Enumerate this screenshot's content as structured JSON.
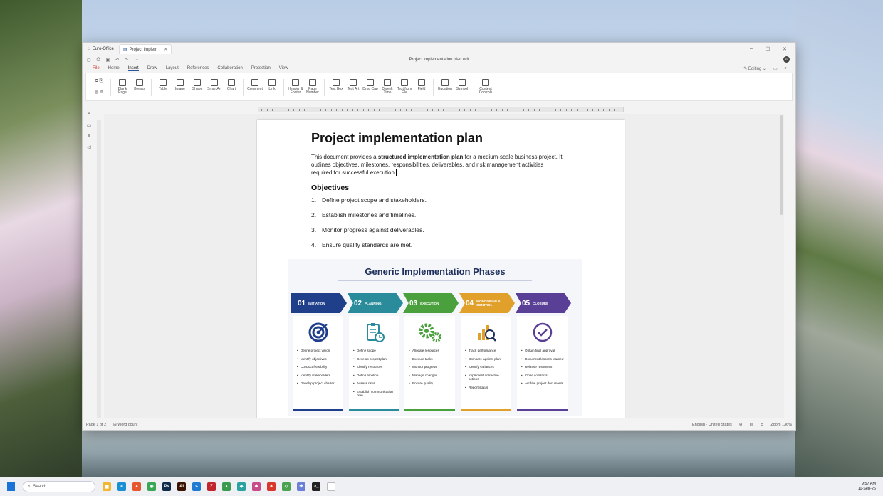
{
  "window": {
    "tabs": [
      {
        "label": "Euro-Office",
        "active": false
      },
      {
        "label": "Project implem",
        "active": true
      }
    ],
    "doc_title": "Project implementation plan.odt",
    "avatar": "EI",
    "menu": [
      "File",
      "Home",
      "Insert",
      "Draw",
      "Layout",
      "References",
      "Collaboration",
      "Protection",
      "View"
    ],
    "active_menu": "Insert",
    "mode": "Editing"
  },
  "ribbon": {
    "buttons": [
      {
        "label": "Blank Page",
        "icon": "blank-page-icon"
      },
      {
        "label": "Breaks",
        "icon": "breaks-icon"
      },
      {
        "label": "Table",
        "icon": "table-icon"
      },
      {
        "label": "Image",
        "icon": "image-icon"
      },
      {
        "label": "Shape",
        "icon": "shape-icon"
      },
      {
        "label": "SmartArt",
        "icon": "smartart-icon"
      },
      {
        "label": "Chart",
        "icon": "chart-icon"
      },
      {
        "label": "Comment",
        "icon": "comment-icon"
      },
      {
        "label": "Link",
        "icon": "link-icon"
      },
      {
        "label": "Header & Footer",
        "icon": "header-footer-icon"
      },
      {
        "label": "Page Number",
        "icon": "page-number-icon"
      },
      {
        "label": "Text Box",
        "icon": "text-box-icon"
      },
      {
        "label": "Text Art",
        "icon": "text-art-icon"
      },
      {
        "label": "Drop Cap",
        "icon": "drop-cap-icon"
      },
      {
        "label": "Date & Time",
        "icon": "date-time-icon"
      },
      {
        "label": "Text from File",
        "icon": "text-from-file-icon"
      },
      {
        "label": "Field",
        "icon": "field-icon"
      },
      {
        "label": "Equation",
        "icon": "equation-icon"
      },
      {
        "label": "Symbol",
        "icon": "symbol-icon"
      },
      {
        "label": "Content Controls",
        "icon": "content-controls-icon"
      }
    ]
  },
  "document": {
    "title": "Project implementation plan",
    "intro_1": "This document provides a ",
    "intro_bold": "structured implementation plan",
    "intro_2": " for a medium-scale business project. It outlines objectives, milestones, responsibilities, deliverables, and risk management activities required for successful execution.",
    "objectives_heading": "Objectives",
    "objectives": [
      {
        "n": "1.",
        "text": "Define project scope and stakeholders."
      },
      {
        "n": "2.",
        "text": "Establish milestones and timelines."
      },
      {
        "n": "3.",
        "text": "Monitor progress against deliverables."
      },
      {
        "n": "4.",
        "text": "Ensure quality standards are met."
      }
    ]
  },
  "infographic": {
    "title": "Generic Implementation Phases",
    "phases": [
      {
        "num": "01",
        "name": "INITIATION",
        "color": "#1f3f8a",
        "icon": "target-icon",
        "items": [
          "Define project vision",
          "Identify objectives",
          "Conduct feasibility",
          "Identify stakeholders",
          "Develop project charter"
        ]
      },
      {
        "num": "02",
        "name": "PLANNING",
        "color": "#2a8c9b",
        "icon": "clipboard-clock-icon",
        "items": [
          "Define scope",
          "Develop project plan",
          "Identify resources",
          "Define timeline",
          "Assess risks",
          "Establish communication plan"
        ]
      },
      {
        "num": "03",
        "name": "EXECUTION",
        "color": "#4aa03c",
        "icon": "gears-icon",
        "items": [
          "Allocate resources",
          "Execute tasks",
          "Monitor progress",
          "Manage changes",
          "Ensure quality"
        ]
      },
      {
        "num": "04",
        "name": "MONITORING & CONTROL",
        "color": "#e0a02a",
        "icon": "chart-magnifier-icon",
        "items": [
          "Track performance",
          "Compare against plan",
          "Identify variances",
          "Implement corrective actions",
          "Report status"
        ]
      },
      {
        "num": "05",
        "name": "CLOSURE",
        "color": "#5a3f96",
        "icon": "checkmark-circle-icon",
        "items": [
          "Obtain final approval",
          "Document lessons learned",
          "Release resources",
          "Close contracts",
          "Archive project documents"
        ]
      }
    ]
  },
  "statusbar": {
    "page": "Page 1 of 2",
    "word_count": "Word count",
    "language": "English · United States",
    "zoom": "Zoom 136%"
  },
  "taskbar": {
    "search_placeholder": "Search",
    "time": "9:57 AM",
    "date": "11-Sep-26",
    "apps": [
      {
        "name": "file-explorer-icon",
        "color": "#f2b632",
        "glyph": "▆"
      },
      {
        "name": "edge-icon",
        "color": "#1b8fd3",
        "glyph": "e"
      },
      {
        "name": "firefox-icon",
        "color": "#e7572d",
        "glyph": "●"
      },
      {
        "name": "chrome-icon",
        "color": "#3aa757",
        "glyph": "◉"
      },
      {
        "name": "photoshop-icon",
        "color": "#0f2a4a",
        "glyph": "Ps"
      },
      {
        "name": "illustrator-icon",
        "color": "#3a1400",
        "glyph": "Ai"
      },
      {
        "name": "vscode-icon",
        "color": "#1e7ad3",
        "glyph": "⌁"
      },
      {
        "name": "filezilla-icon",
        "color": "#c0262d",
        "glyph": "Z"
      },
      {
        "name": "app-green-icon",
        "color": "#3a9a4d",
        "glyph": "♦"
      },
      {
        "name": "app-teal-icon",
        "color": "#2aa3a0",
        "glyph": "◆"
      },
      {
        "name": "app-colorwheel-icon",
        "color": "#c74a8a",
        "glyph": "✱"
      },
      {
        "name": "app-red-icon",
        "color": "#d9372b",
        "glyph": "✶"
      },
      {
        "name": "app-diamond-icon",
        "color": "#4ba24f",
        "glyph": "◇"
      },
      {
        "name": "app-puzzle-icon",
        "color": "#6b7fd6",
        "glyph": "✚"
      },
      {
        "name": "terminal-icon",
        "color": "#222222",
        "glyph": ">_"
      },
      {
        "name": "blank-doc-icon",
        "color": "#ffffff",
        "glyph": ""
      }
    ]
  }
}
